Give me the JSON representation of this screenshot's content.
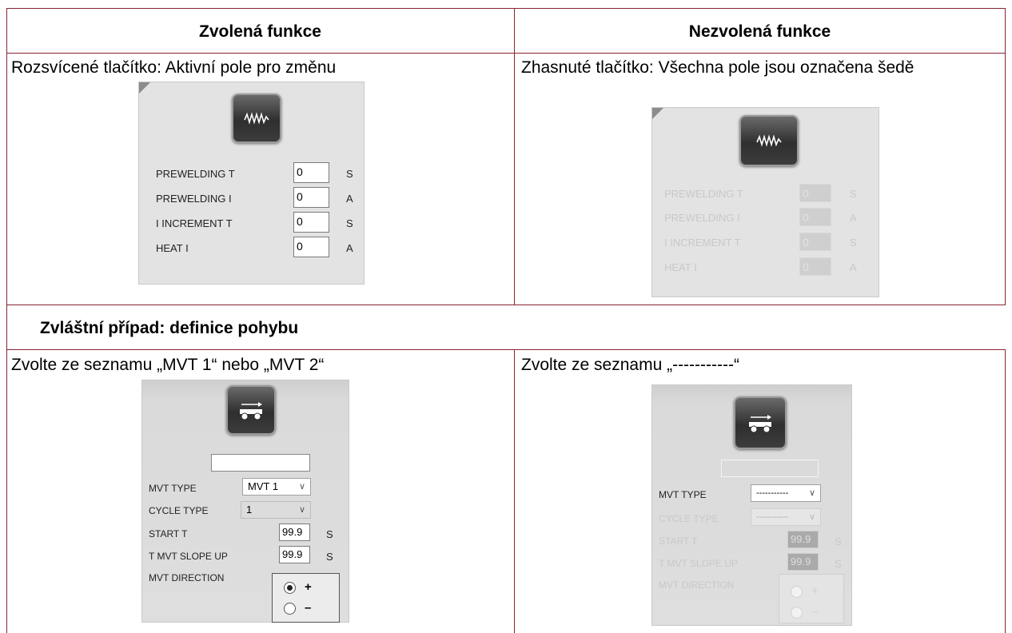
{
  "header": {
    "left": "Zvolená funkce",
    "right": "Nezvolená funkce"
  },
  "row1": {
    "left_text": "Rozsvícené tlačítko: Aktivní pole pro změnu",
    "right_text": "Zhasnuté tlačítko: Všechna pole jsou označena šedě"
  },
  "section": {
    "title": "Zvláštní případ: definice pohybu"
  },
  "row2": {
    "left_text": "Zvolte ze seznamu „MVT 1“ nebo „MVT 2“",
    "right_text": "Zvolte ze seznamu „-----------“"
  },
  "weld_panel": {
    "icon": "weld-wave-icon",
    "fields": [
      {
        "label": "PREWELDING T",
        "value": "0",
        "unit": "S"
      },
      {
        "label": "PREWELDING I",
        "value": "0",
        "unit": "A"
      },
      {
        "label": "I INCREMENT T",
        "value": "0",
        "unit": "S"
      },
      {
        "label": "HEAT I",
        "value": "0",
        "unit": "A"
      }
    ]
  },
  "mvt_active": {
    "icon": "carriage-arrow-icon",
    "name_value": "",
    "mvt_type_label": "MVT TYPE",
    "mvt_type_value": "MVT 1",
    "cycle_type_label": "CYCLE TYPE",
    "cycle_type_value": "1",
    "start_t_label": "START T",
    "start_t_value": "99.9",
    "start_t_unit": "S",
    "slope_label": "T MVT SLOPE UP",
    "slope_value": "99.9",
    "slope_unit": "S",
    "direction_label": "MVT DIRECTION",
    "plus": "+",
    "minus": "–",
    "selected": "+"
  },
  "mvt_inactive": {
    "icon": "carriage-arrow-icon",
    "name_value": "",
    "mvt_type_label": "MVT TYPE",
    "mvt_type_value": "-----------",
    "cycle_type_label": "CYCLE TYPE",
    "cycle_type_value": "-----------",
    "start_t_label": "START T",
    "start_t_value": "99.9",
    "start_t_unit": "S",
    "slope_label": "T MVT SLOPE UP",
    "slope_value": "99.9",
    "slope_unit": "S",
    "direction_label": "MVT DIRECTION",
    "plus": "+",
    "minus": "–"
  },
  "colors": {
    "table_border": "#8a2432",
    "panel_bg": "#e3e3e3"
  }
}
